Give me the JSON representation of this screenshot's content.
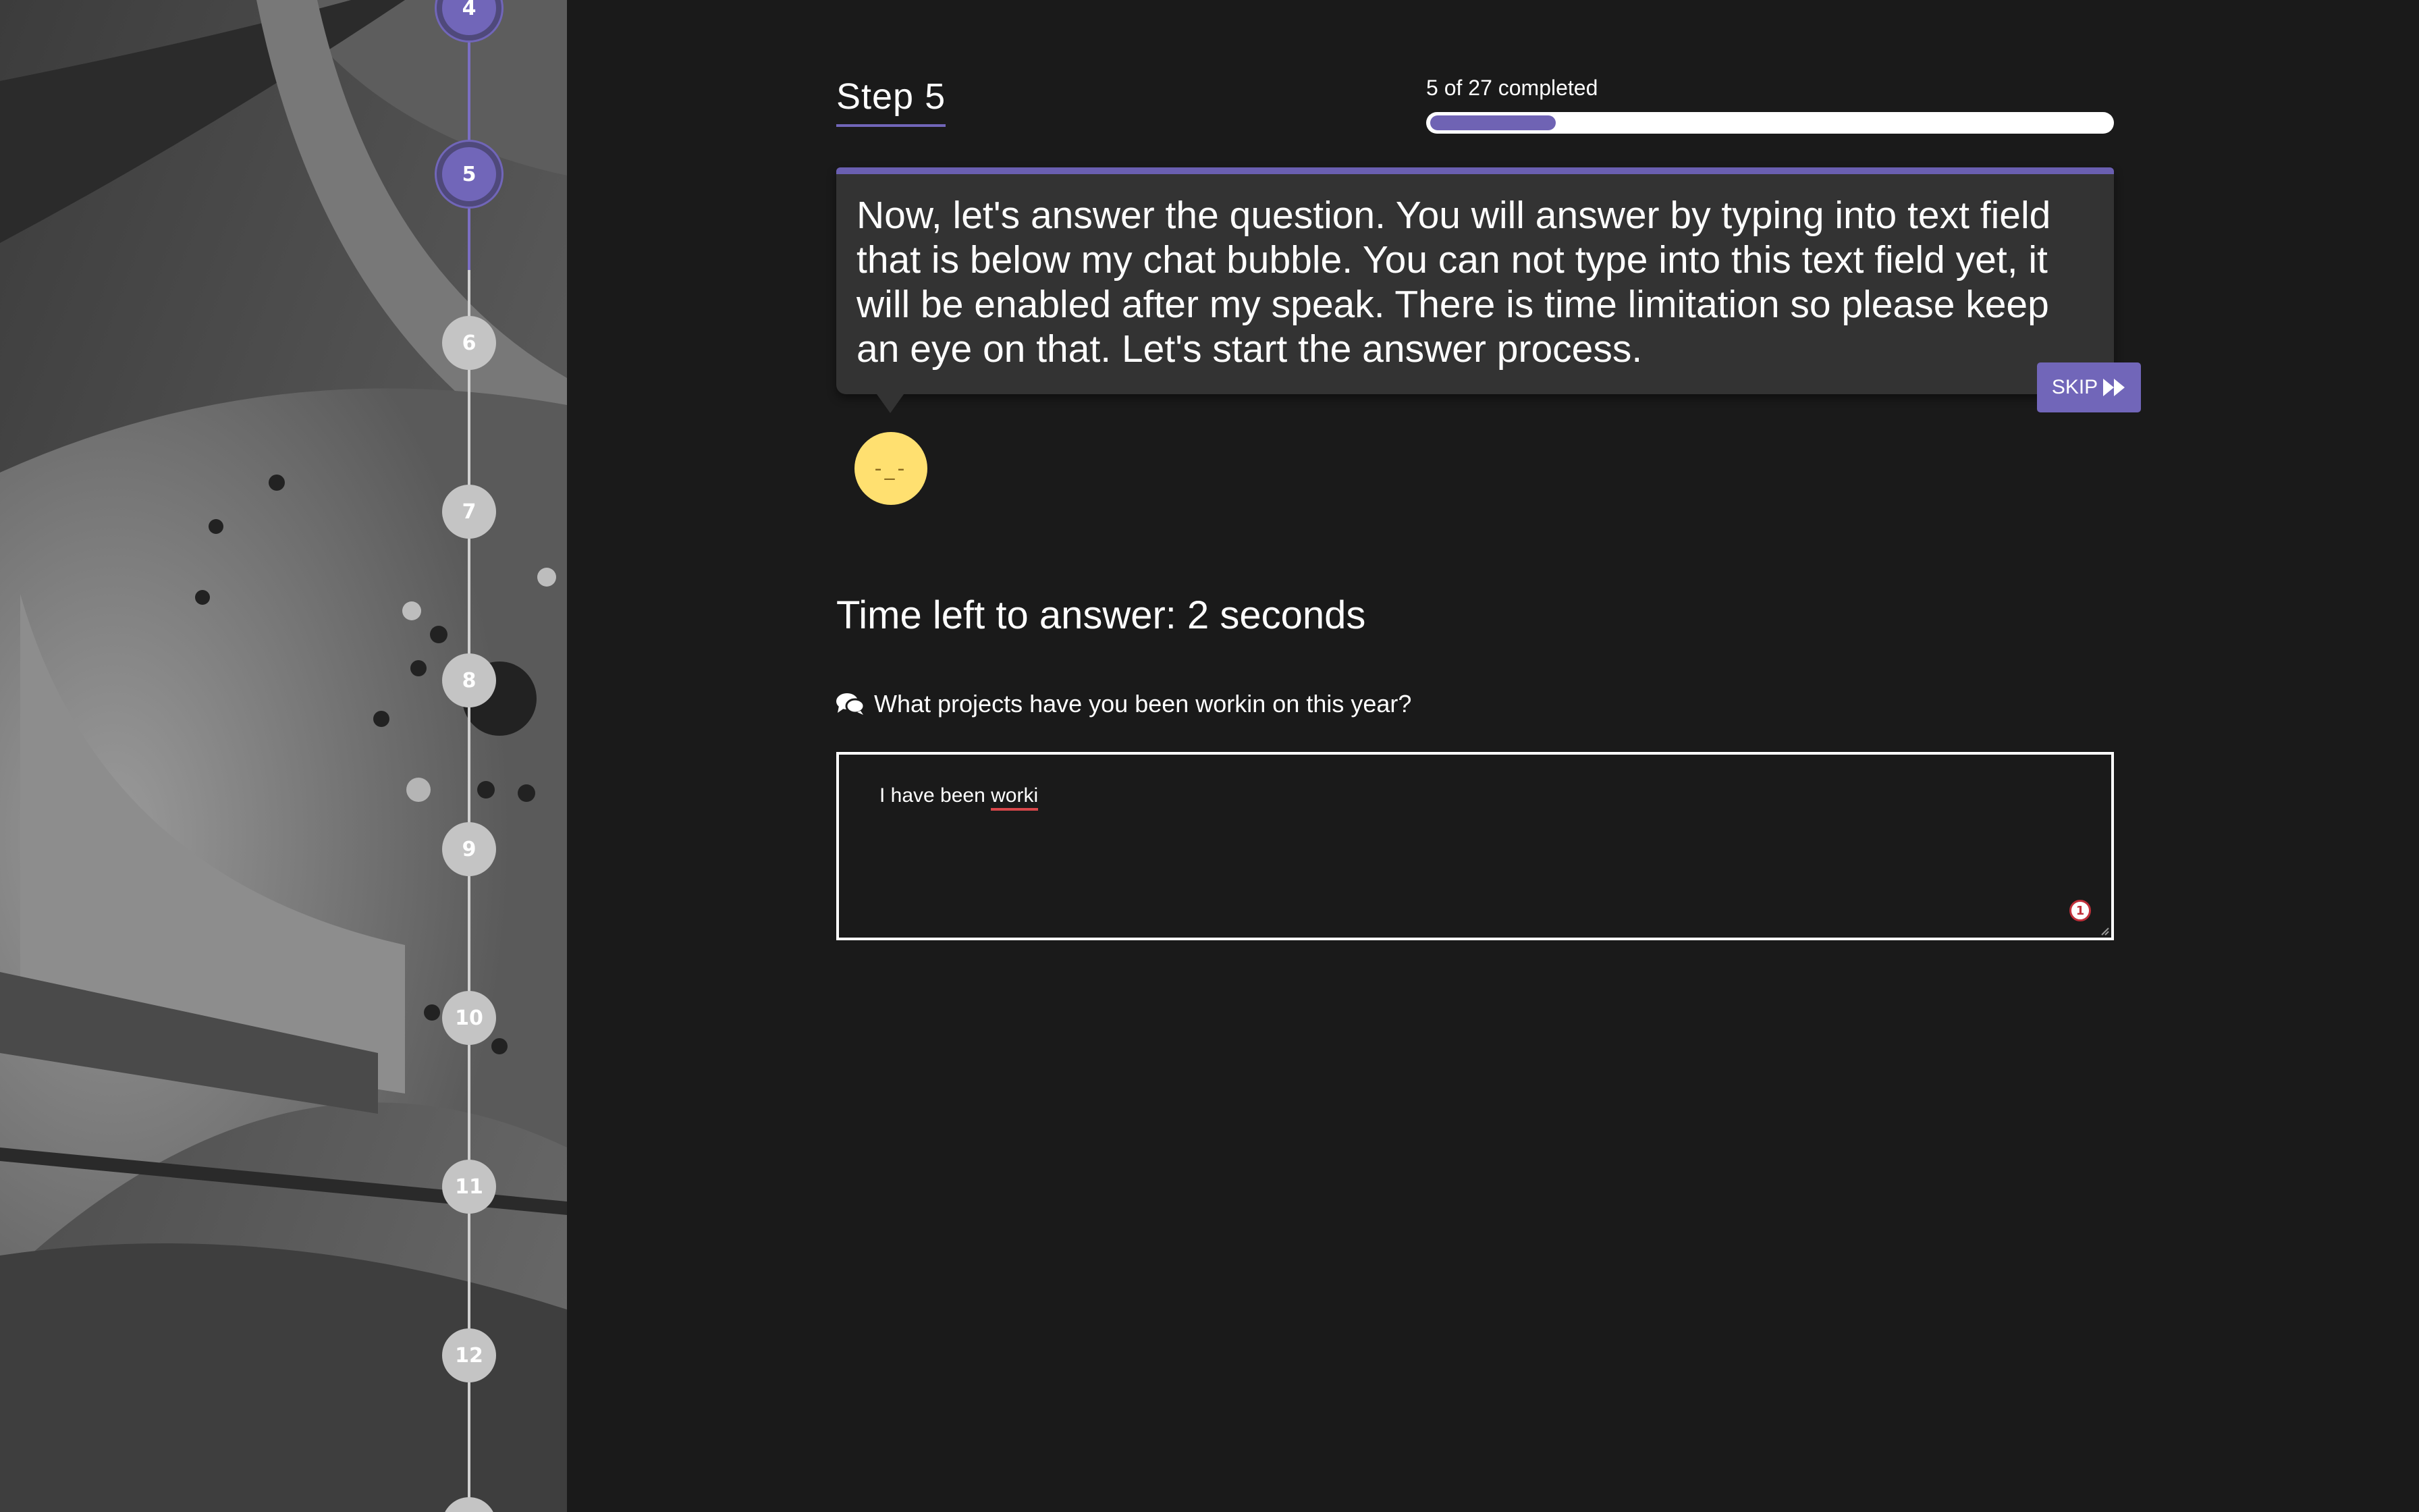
{
  "sidebar": {
    "steps": [
      "4",
      "5",
      "6",
      "7",
      "8",
      "9",
      "10",
      "11",
      "12"
    ],
    "current_step": 5
  },
  "header": {
    "step_title": "Step 5",
    "progress_label": "5 of 27 completed",
    "progress": {
      "completed": 5,
      "total": 27
    }
  },
  "bubble": {
    "text": "Now, let's answer the question. You will answer by typing into text field that is below my chat bubble. You can not type into this text field yet, it will be enabled after my speak. There is time limitation so please keep an eye on that. Let's start the answer process.",
    "skip_label": "SKIP"
  },
  "avatar": {
    "face": "-_-"
  },
  "timer": {
    "text": "Time left to answer: 2 seconds"
  },
  "question": {
    "icon": "comments-icon",
    "text": "What projects have you been workin on this year?"
  },
  "answer": {
    "value_prefix": "I have been ",
    "value_misspelled": "worki",
    "spellcheck_count": "1"
  },
  "colors": {
    "accent": "#7166b9",
    "background": "#1a1a1a",
    "bubble": "#333333",
    "avatar": "#ffe070",
    "spell_error": "#d8474b"
  }
}
